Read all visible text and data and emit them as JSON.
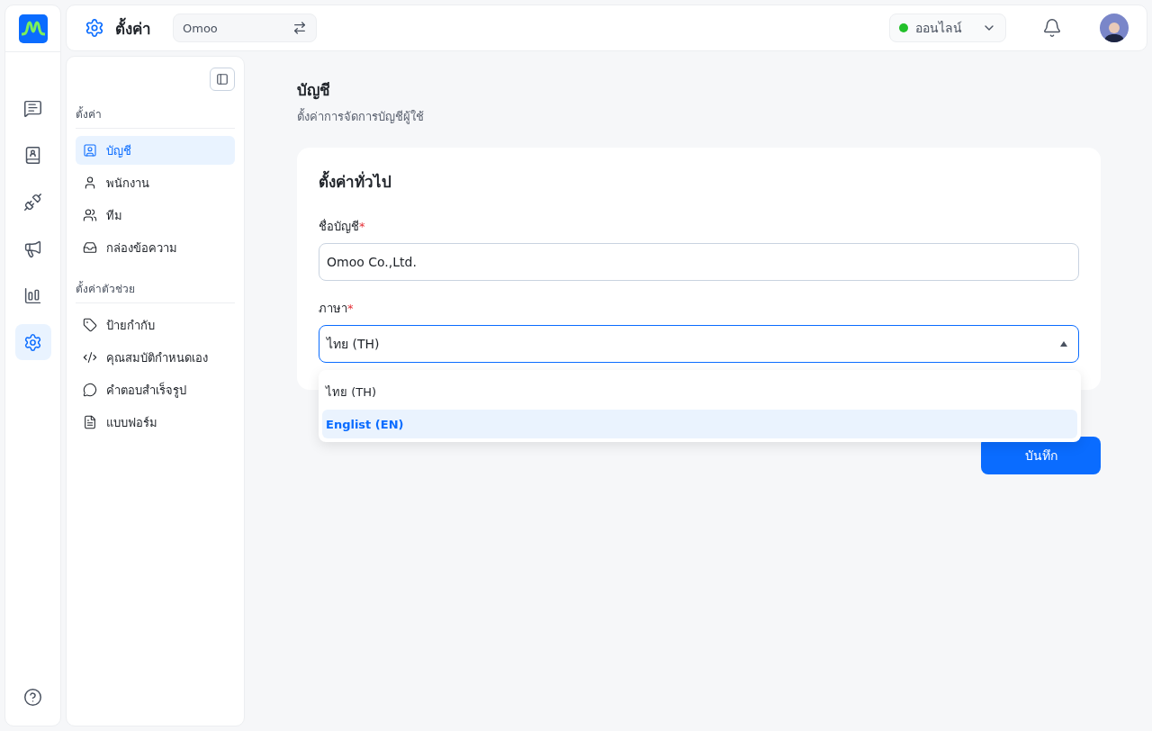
{
  "topbar": {
    "title": "ตั้งค่า",
    "workspace": "Omoo",
    "status": {
      "label": "ออนไลน์",
      "color": "#22c02a"
    }
  },
  "rail": [
    {
      "selected": false
    },
    {
      "selected": false
    },
    {
      "selected": false
    },
    {
      "selected": false
    },
    {
      "selected": false
    },
    {
      "selected": true
    }
  ],
  "sidebar": {
    "groups": [
      {
        "title": "ตั้งค่า",
        "items": [
          {
            "label": "บัญชี",
            "selected": true
          },
          {
            "label": "พนักงาน",
            "selected": false
          },
          {
            "label": "ทีม",
            "selected": false
          },
          {
            "label": "กล่องข้อความ",
            "selected": false
          }
        ]
      },
      {
        "title": "ตั้งค่าตัวช่วย",
        "items": [
          {
            "label": "ป้ายกำกับ",
            "selected": false
          },
          {
            "label": "คุณสมบัติกำหนดเอง",
            "selected": false
          },
          {
            "label": "คำตอบสำเร็จรูป",
            "selected": false
          },
          {
            "label": "แบบฟอร์ม",
            "selected": false
          }
        ]
      }
    ]
  },
  "page": {
    "title": "บัญชี",
    "subtitle": "ตั้งค่าการจัดการบัญชีผู้ใช้"
  },
  "card": {
    "title": "ตั้งค่าทั่วไป",
    "fields": [
      {
        "kind": "text",
        "label": "ชื่อบัญชี",
        "required_mark": "*",
        "value": "Omoo Co.,Ltd."
      },
      {
        "kind": "select",
        "label": "ภาษา",
        "required_mark": "*",
        "value": "ไทย (TH)",
        "expanded": true,
        "options": [
          {
            "label": "ไทย (TH)",
            "highlighted": false
          },
          {
            "label": "Englist (EN)",
            "highlighted": true
          }
        ]
      }
    ]
  },
  "save_button": "บันทึก"
}
